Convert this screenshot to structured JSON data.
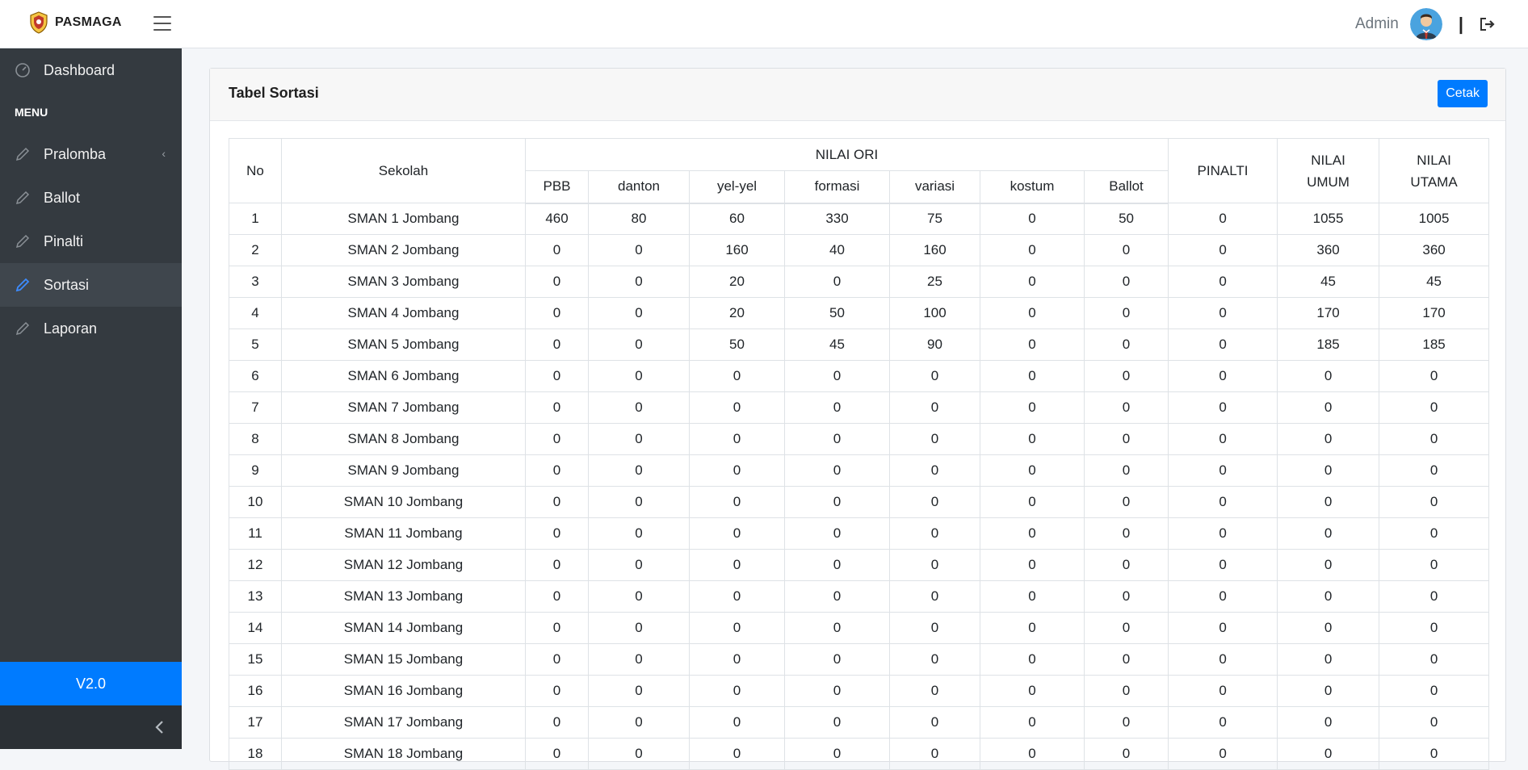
{
  "app": {
    "name": "PASMAGA"
  },
  "user": {
    "name": "Admin"
  },
  "separator": "|",
  "sidebar": {
    "dashboard": "Dashboard",
    "menu_header": "MENU",
    "items": [
      {
        "label": "Pralomba"
      },
      {
        "label": "Ballot"
      },
      {
        "label": "Pinalti"
      },
      {
        "label": "Sortasi"
      },
      {
        "label": "Laporan"
      }
    ],
    "version": "V2.0"
  },
  "colors": {
    "accent": "#007bff",
    "sidebar": "#343a40"
  },
  "card": {
    "title": "Tabel Sortasi",
    "print_label": "Cetak"
  },
  "table": {
    "headers": {
      "no": "No",
      "sekolah": "Sekolah",
      "nilai_ori": "NILAI ORI",
      "pinalti": "PINALTI",
      "nilai_umum": "NILAI UMUM",
      "nilai_utama": "NILAI UTAMA",
      "sub": [
        "PBB",
        "danton",
        "yel-yel",
        "formasi",
        "variasi",
        "kostum",
        "Ballot"
      ]
    },
    "rows": [
      [
        "1",
        "SMAN 1 Jombang",
        "460",
        "80",
        "60",
        "330",
        "75",
        "0",
        "50",
        "0",
        "1055",
        "1005"
      ],
      [
        "2",
        "SMAN 2 Jombang",
        "0",
        "0",
        "160",
        "40",
        "160",
        "0",
        "0",
        "0",
        "360",
        "360"
      ],
      [
        "3",
        "SMAN 3 Jombang",
        "0",
        "0",
        "20",
        "0",
        "25",
        "0",
        "0",
        "0",
        "45",
        "45"
      ],
      [
        "4",
        "SMAN 4 Jombang",
        "0",
        "0",
        "20",
        "50",
        "100",
        "0",
        "0",
        "0",
        "170",
        "170"
      ],
      [
        "5",
        "SMAN 5 Jombang",
        "0",
        "0",
        "50",
        "45",
        "90",
        "0",
        "0",
        "0",
        "185",
        "185"
      ],
      [
        "6",
        "SMAN 6 Jombang",
        "0",
        "0",
        "0",
        "0",
        "0",
        "0",
        "0",
        "0",
        "0",
        "0"
      ],
      [
        "7",
        "SMAN 7 Jombang",
        "0",
        "0",
        "0",
        "0",
        "0",
        "0",
        "0",
        "0",
        "0",
        "0"
      ],
      [
        "8",
        "SMAN 8 Jombang",
        "0",
        "0",
        "0",
        "0",
        "0",
        "0",
        "0",
        "0",
        "0",
        "0"
      ],
      [
        "9",
        "SMAN 9 Jombang",
        "0",
        "0",
        "0",
        "0",
        "0",
        "0",
        "0",
        "0",
        "0",
        "0"
      ],
      [
        "10",
        "SMAN 10 Jombang",
        "0",
        "0",
        "0",
        "0",
        "0",
        "0",
        "0",
        "0",
        "0",
        "0"
      ],
      [
        "11",
        "SMAN 11 Jombang",
        "0",
        "0",
        "0",
        "0",
        "0",
        "0",
        "0",
        "0",
        "0",
        "0"
      ],
      [
        "12",
        "SMAN 12 Jombang",
        "0",
        "0",
        "0",
        "0",
        "0",
        "0",
        "0",
        "0",
        "0",
        "0"
      ],
      [
        "13",
        "SMAN 13 Jombang",
        "0",
        "0",
        "0",
        "0",
        "0",
        "0",
        "0",
        "0",
        "0",
        "0"
      ],
      [
        "14",
        "SMAN 14 Jombang",
        "0",
        "0",
        "0",
        "0",
        "0",
        "0",
        "0",
        "0",
        "0",
        "0"
      ],
      [
        "15",
        "SMAN 15 Jombang",
        "0",
        "0",
        "0",
        "0",
        "0",
        "0",
        "0",
        "0",
        "0",
        "0"
      ],
      [
        "16",
        "SMAN 16 Jombang",
        "0",
        "0",
        "0",
        "0",
        "0",
        "0",
        "0",
        "0",
        "0",
        "0"
      ],
      [
        "17",
        "SMAN 17 Jombang",
        "0",
        "0",
        "0",
        "0",
        "0",
        "0",
        "0",
        "0",
        "0",
        "0"
      ],
      [
        "18",
        "SMAN 18 Jombang",
        "0",
        "0",
        "0",
        "0",
        "0",
        "0",
        "0",
        "0",
        "0",
        "0"
      ]
    ]
  }
}
